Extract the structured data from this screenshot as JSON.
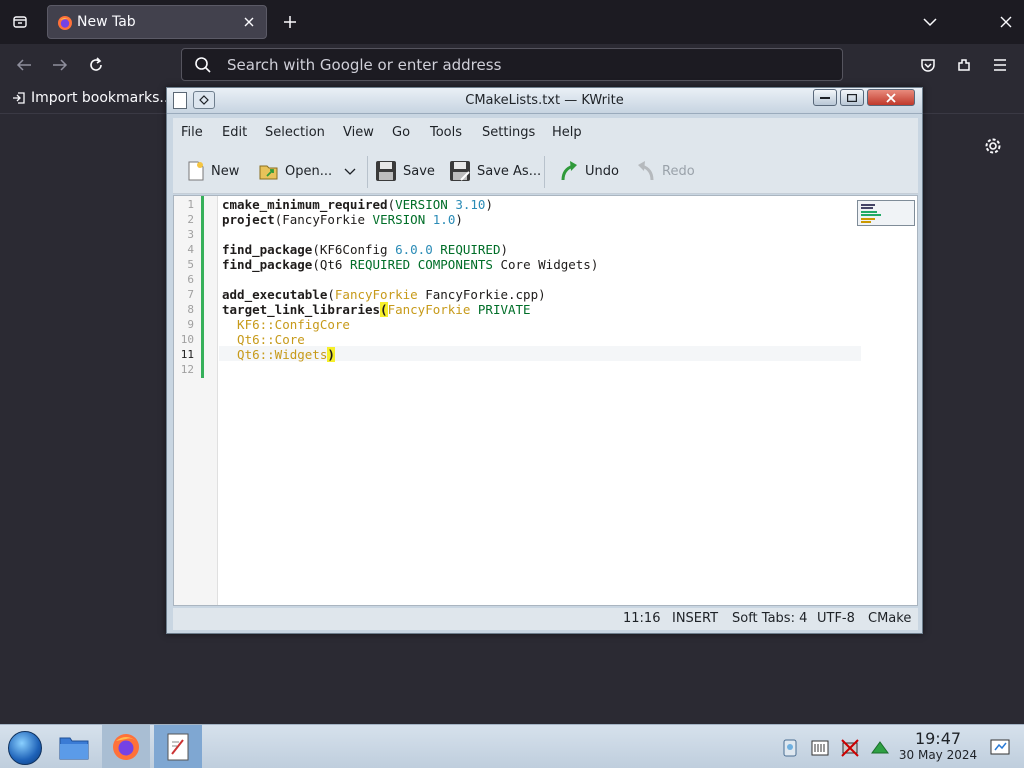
{
  "browser": {
    "tab_title": "New Tab",
    "url_placeholder": "Search with Google or enter address",
    "bookmark_import_label": "Import bookmarks..."
  },
  "kwrite": {
    "window_title": "CMakeLists.txt — KWrite",
    "menu": [
      "File",
      "Edit",
      "Selection",
      "View",
      "Go",
      "Tools",
      "Settings",
      "Help"
    ],
    "toolbar": {
      "new": "New",
      "open": "Open...",
      "save": "Save",
      "save_as": "Save As...",
      "undo": "Undo",
      "redo": "Redo"
    },
    "line_numbers": [
      "1",
      "2",
      "3",
      "4",
      "5",
      "6",
      "7",
      "8",
      "9",
      "10",
      "11",
      "12"
    ],
    "current_line": 11,
    "status": {
      "cursor": "11:16",
      "mode": "INSERT",
      "indent": "Soft Tabs: 4",
      "encoding": "UTF-8",
      "syntax": "CMake"
    },
    "code_lines": [
      "cmake_minimum_required(VERSION 3.10)",
      "project(FancyForkie VERSION 1.0)",
      "",
      "find_package(KF6Config 6.0.0 REQUIRED)",
      "find_package(Qt6 REQUIRED COMPONENTS Core Widgets)",
      "",
      "add_executable(FancyForkie FancyForkie.cpp)",
      "target_link_libraries(FancyForkie PRIVATE",
      "  KF6::ConfigCore",
      "  Qt6::Core",
      "  Qt6::Widgets)",
      ""
    ]
  },
  "taskbar": {
    "time": "19:47",
    "date": "30 May 2024"
  },
  "colors": {
    "browser_bg": "#2b2a33",
    "editor_keyword": "#006e28",
    "editor_number": "#2a8bb6",
    "editor_target": "#c79a1a",
    "bracket_highlight": "#f6ef2a"
  }
}
